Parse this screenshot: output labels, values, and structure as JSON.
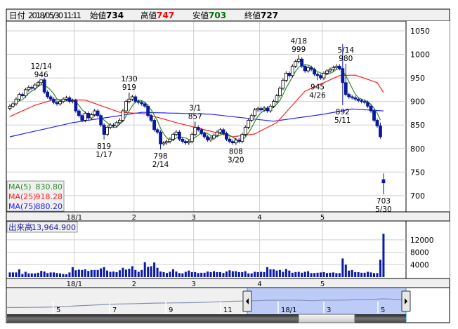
{
  "header": {
    "date_label": "日付",
    "date_value": "2018/05/30 11:11",
    "open_label": "始値",
    "open_value": "734",
    "high_label": "高値",
    "high_value": "747",
    "low_label": "安値",
    "low_value": "703",
    "close_label": "終値",
    "close_value": "727"
  },
  "colors": {
    "up_fill": "#ffffff",
    "down_fill": "#0a1a9a",
    "ma5": "#2e8b2e",
    "ma25": "#ff2020",
    "ma75": "#2020ff",
    "high_text": "#ff0000",
    "low_text": "#007000"
  },
  "legend": [
    {
      "name": "MA(5)",
      "value": "830.80",
      "color": "#2e8b2e"
    },
    {
      "name": "MA(25)",
      "value": "918.28",
      "color": "#ff2020"
    },
    {
      "name": "MA(75)",
      "value": "880.20",
      "color": "#2020ff"
    }
  ],
  "volume_legend": {
    "label": "出来高",
    "value": "13,964.900"
  },
  "month_ticks": [
    {
      "label": "18/1",
      "index": 21
    },
    {
      "label": "2",
      "index": 40
    },
    {
      "label": "3",
      "index": 59
    },
    {
      "label": "4",
      "index": 80
    },
    {
      "label": "5",
      "index": 100
    }
  ],
  "chart_data": {
    "type": "candlestick",
    "price_axis": {
      "ticks": [
        700,
        750,
        800,
        850,
        900,
        950,
        1000,
        1050
      ]
    },
    "volume_axis": {
      "ticks": [
        4000,
        8000,
        12000
      ]
    },
    "close": [
      890,
      895,
      905,
      915,
      912,
      925,
      930,
      928,
      935,
      940,
      946,
      920,
      910,
      905,
      898,
      895,
      900,
      905,
      908,
      900,
      902,
      880,
      870,
      860,
      875,
      865,
      872,
      880,
      870,
      850,
      830,
      845,
      850,
      848,
      855,
      860,
      880,
      900,
      905,
      910,
      900,
      898,
      895,
      890,
      870,
      860,
      840,
      835,
      810,
      812,
      815,
      820,
      830,
      835,
      820,
      815,
      812,
      815,
      830,
      845,
      840,
      832,
      825,
      818,
      822,
      828,
      835,
      840,
      832,
      820,
      815,
      812,
      818,
      815,
      830,
      845,
      860,
      870,
      882,
      885,
      882,
      886,
      880,
      890,
      900,
      912,
      928,
      945,
      960,
      955,
      975,
      985,
      990,
      975,
      965,
      972,
      968,
      958,
      955,
      950,
      960,
      965,
      968,
      972,
      975,
      970,
      940,
      915,
      910,
      908,
      905,
      902,
      900,
      898,
      890,
      880,
      860,
      848,
      825,
      727
    ],
    "open": [
      885,
      890,
      895,
      905,
      915,
      912,
      925,
      930,
      928,
      935,
      940,
      946,
      920,
      910,
      905,
      898,
      895,
      900,
      905,
      908,
      900,
      902,
      880,
      870,
      860,
      875,
      865,
      872,
      880,
      870,
      850,
      830,
      845,
      850,
      848,
      855,
      860,
      880,
      900,
      905,
      910,
      900,
      898,
      895,
      890,
      870,
      860,
      840,
      835,
      810,
      812,
      815,
      820,
      830,
      835,
      820,
      815,
      812,
      815,
      830,
      845,
      840,
      832,
      825,
      818,
      822,
      828,
      835,
      840,
      832,
      820,
      815,
      812,
      818,
      815,
      830,
      845,
      860,
      870,
      882,
      885,
      882,
      886,
      880,
      890,
      900,
      912,
      928,
      945,
      960,
      955,
      975,
      985,
      990,
      975,
      965,
      972,
      968,
      958,
      955,
      950,
      960,
      965,
      968,
      972,
      975,
      970,
      940,
      915,
      910,
      908,
      905,
      902,
      900,
      898,
      890,
      880,
      860,
      848,
      734
    ],
    "extremes": [
      {
        "index": 10,
        "date": "12/14",
        "value": "946",
        "kind": "high"
      },
      {
        "index": 30,
        "date": "1/17",
        "value": "819",
        "kind": "low"
      },
      {
        "index": 38,
        "date": "1/30",
        "value": "919",
        "kind": "high"
      },
      {
        "index": 48,
        "date": "2/14",
        "value": "798",
        "kind": "low"
      },
      {
        "index": 59,
        "date": "3/1",
        "value": "857",
        "kind": "high"
      },
      {
        "index": 72,
        "date": "3/20",
        "value": "808",
        "kind": "low"
      },
      {
        "index": 92,
        "date": "4/18",
        "value": "999",
        "kind": "high"
      },
      {
        "index": 98,
        "date": "4/26",
        "value": "945",
        "kind": "low"
      },
      {
        "index": 106,
        "date": "5/11",
        "value": "892",
        "kind": "low"
      },
      {
        "index": 107,
        "date": "5/14",
        "value": "980",
        "kind": "high"
      },
      {
        "index": 119,
        "date": "5/30",
        "value": "703",
        "kind": "low"
      }
    ],
    "spike_highs": [
      {
        "index": 106,
        "value": 1022
      },
      {
        "index": 119,
        "value": 747
      },
      {
        "index": 118,
        "value": 855
      }
    ],
    "ma25": [
      [
        0,
        868
      ],
      [
        8,
        892
      ],
      [
        14,
        904
      ],
      [
        24,
        903
      ],
      [
        35,
        877
      ],
      [
        43,
        874
      ],
      [
        53,
        855
      ],
      [
        62,
        840
      ],
      [
        71,
        825
      ],
      [
        78,
        831
      ],
      [
        85,
        855
      ],
      [
        94,
        922
      ],
      [
        105,
        955
      ],
      [
        110,
        956
      ],
      [
        117,
        940
      ],
      [
        119,
        919
      ]
    ],
    "ma75": [
      [
        0,
        825
      ],
      [
        20,
        855
      ],
      [
        42,
        877
      ],
      [
        64,
        873
      ],
      [
        84,
        858
      ],
      [
        100,
        873
      ],
      [
        109,
        884
      ],
      [
        119,
        880
      ]
    ],
    "volume": [
      1500,
      1500,
      1500,
      2500,
      1000,
      1700,
      1200,
      1200,
      1200,
      1400,
      2000,
      1800,
      1300,
      1500,
      1500,
      1300,
      1200,
      1000,
      900,
      1500,
      3200,
      2200,
      2400,
      2300,
      2500,
      2000,
      2300,
      2300,
      2300,
      2800,
      3200,
      2100,
      1700,
      1800,
      1600,
      2200,
      3000,
      2400,
      2700,
      3500,
      2300,
      1700,
      2300,
      4800,
      3300,
      3500,
      4700,
      3000,
      1800,
      1600,
      1300,
      1700,
      2500,
      1800,
      1300,
      1200,
      1700,
      2100,
      1600,
      1600,
      1300,
      1400,
      1400,
      1800,
      1600,
      1900,
      1600,
      1600,
      1300,
      1800,
      2200,
      1900,
      1900,
      1600,
      1600,
      1900,
      1200,
      1200,
      1700,
      1600,
      1700,
      1600,
      3200,
      2500,
      2500,
      2100,
      2300,
      1700,
      2600,
      2100,
      1400,
      1600,
      1700,
      1400,
      1700,
      1900,
      1300,
      1300,
      1400,
      1500,
      1600,
      1300,
      1400,
      1500,
      1300,
      1300,
      6000,
      4000,
      2100,
      2300,
      1600,
      1600,
      1400,
      1400,
      1700,
      1500,
      1300,
      1300,
      5600,
      13965
    ]
  },
  "navigator": {
    "labels": [
      "5",
      "7",
      "9",
      "11",
      "18/1",
      "3",
      "5"
    ],
    "series": [
      640,
      640,
      645,
      650,
      660,
      680,
      700,
      720,
      740,
      760,
      770,
      780,
      790,
      800,
      805,
      810,
      815,
      830,
      845,
      860,
      870,
      880,
      895,
      900,
      905,
      900,
      880,
      905,
      900,
      910,
      930,
      925,
      950,
      935,
      925
    ],
    "left_handle_icon": "arrow-left-icon",
    "right_handle_icon": "arrow-right-icon"
  }
}
